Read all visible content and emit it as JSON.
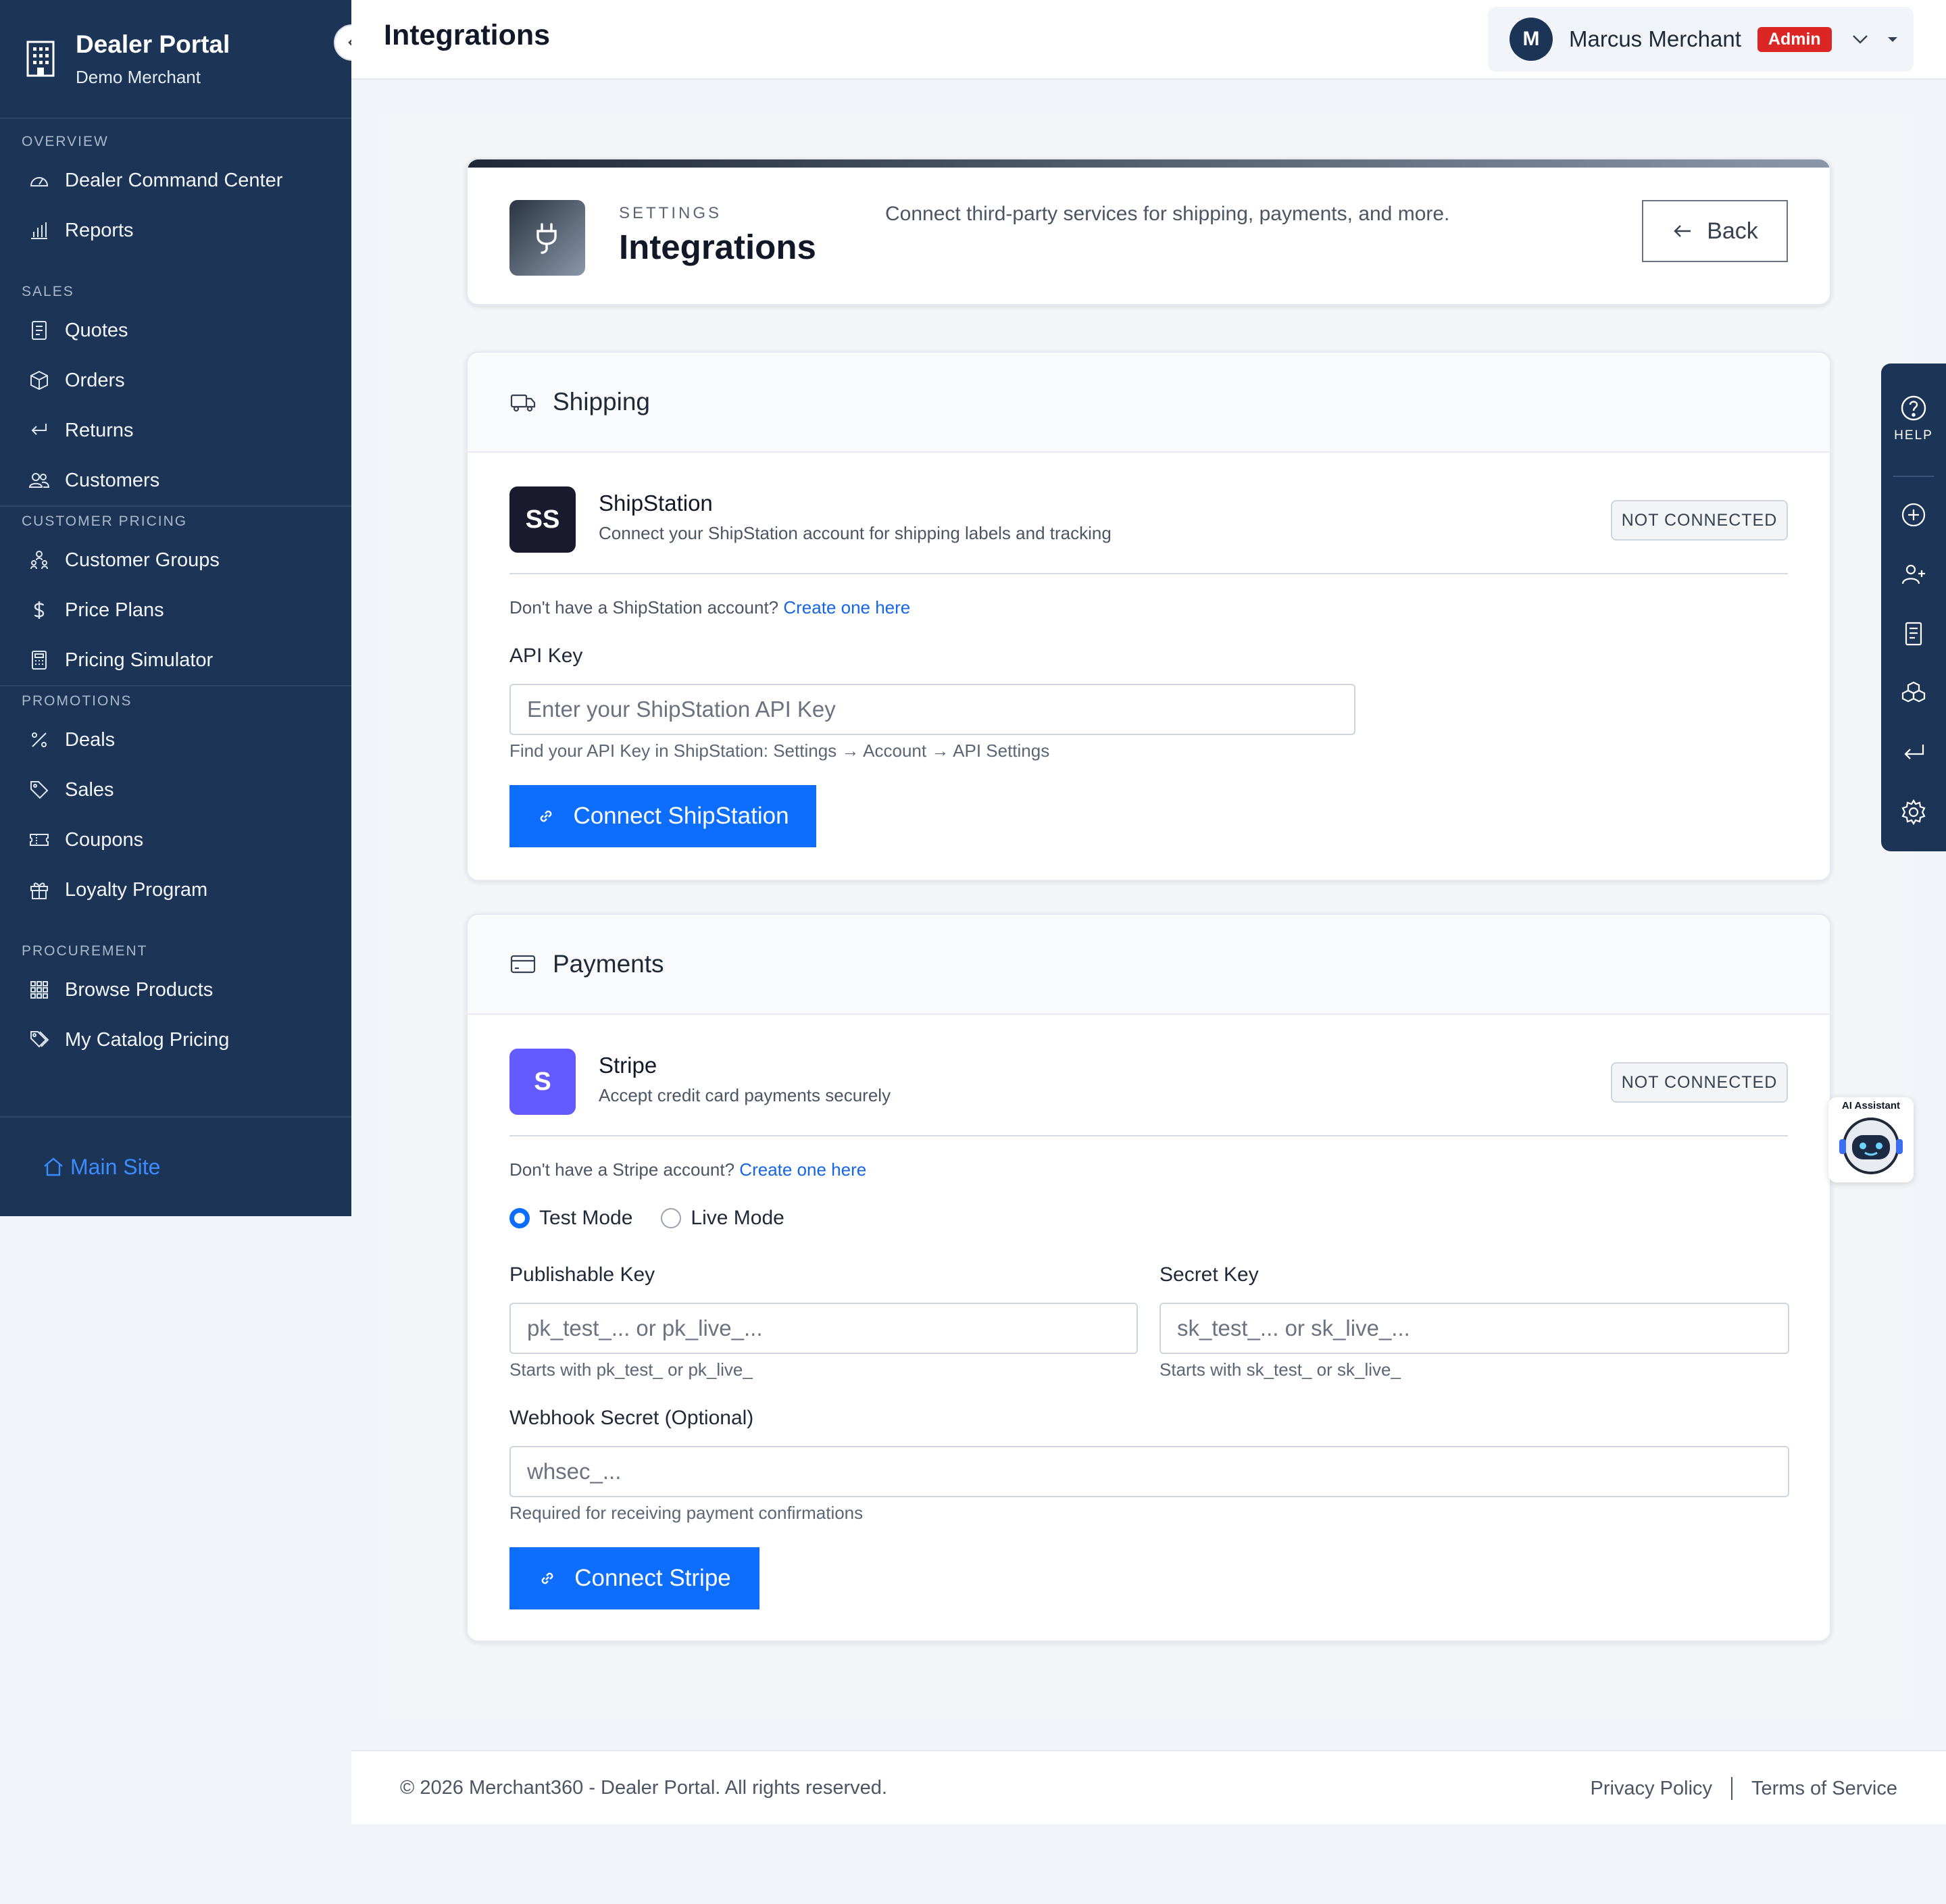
{
  "sidebar": {
    "brand_title": "Dealer Portal",
    "brand_subtitle": "Demo Merchant",
    "sections": {
      "overview": "OVERVIEW",
      "sales": "SALES",
      "customer_pricing": "CUSTOMER PRICING",
      "promotions": "PROMOTIONS",
      "procurement": "PROCUREMENT"
    },
    "items": {
      "dealer_command_center": "Dealer Command Center",
      "reports": "Reports",
      "quotes": "Quotes",
      "orders": "Orders",
      "returns": "Returns",
      "customers": "Customers",
      "customer_groups": "Customer Groups",
      "price_plans": "Price Plans",
      "pricing_simulator": "Pricing Simulator",
      "deals": "Deals",
      "sales": "Sales",
      "coupons": "Coupons",
      "loyalty_program": "Loyalty Program",
      "browse_products": "Browse Products",
      "my_catalog_pricing": "My Catalog Pricing"
    },
    "main_site": "Main Site"
  },
  "header": {
    "title": "Integrations",
    "user_initial": "M",
    "user_name": "Marcus Merchant",
    "role_badge": "Admin"
  },
  "page_header": {
    "eyebrow": "SETTINGS",
    "title": "Integrations",
    "description": "Connect third-party services for shipping, payments, and more.",
    "back_label": "Back"
  },
  "shipping": {
    "section_title": "Shipping",
    "service_initials": "SS",
    "service_name": "ShipStation",
    "service_desc": "Connect your ShipStation account for shipping labels and tracking",
    "status": "NOT CONNECTED",
    "account_hint": "Don't have a ShipStation account?",
    "create_link": "Create one here",
    "api_key_label": "API Key",
    "api_key_placeholder": "Enter your ShipStation API Key",
    "api_key_value": "",
    "api_key_help": "Find your API Key in ShipStation: Settings → Account → API Settings",
    "connect_label": "Connect ShipStation"
  },
  "payments": {
    "section_title": "Payments",
    "service_initials": "S",
    "service_name": "Stripe",
    "service_desc": "Accept credit card payments securely",
    "status": "NOT CONNECTED",
    "account_hint": "Don't have a Stripe account?",
    "create_link": "Create one here",
    "mode_test": "Test Mode",
    "mode_live": "Live Mode",
    "selected_mode": "test",
    "publishable_label": "Publishable Key",
    "publishable_placeholder": "pk_test_... or pk_live_...",
    "publishable_help": "Starts with pk_test_ or pk_live_",
    "secret_label": "Secret Key",
    "secret_placeholder": "sk_test_... or sk_live_...",
    "secret_help": "Starts with sk_test_ or sk_live_",
    "webhook_label": "Webhook Secret (Optional)",
    "webhook_placeholder": "whsec_...",
    "webhook_help": "Required for receiving payment confirmations",
    "connect_label": "Connect Stripe"
  },
  "help_rail": {
    "help_label": "HELP"
  },
  "ai_widget": {
    "label": "AI Assistant"
  },
  "footer": {
    "copyright": "© 2026 Merchant360 - Dealer Portal. All rights reserved.",
    "privacy": "Privacy Policy",
    "terms": "Terms of Service"
  },
  "colors": {
    "sidebar_bg": "#1c3557",
    "primary": "#0d6efd",
    "admin_badge": "#dc2626",
    "stripe_tile": "#635bff",
    "shipstation_tile": "#1a1a2e",
    "link": "#1565e6"
  }
}
